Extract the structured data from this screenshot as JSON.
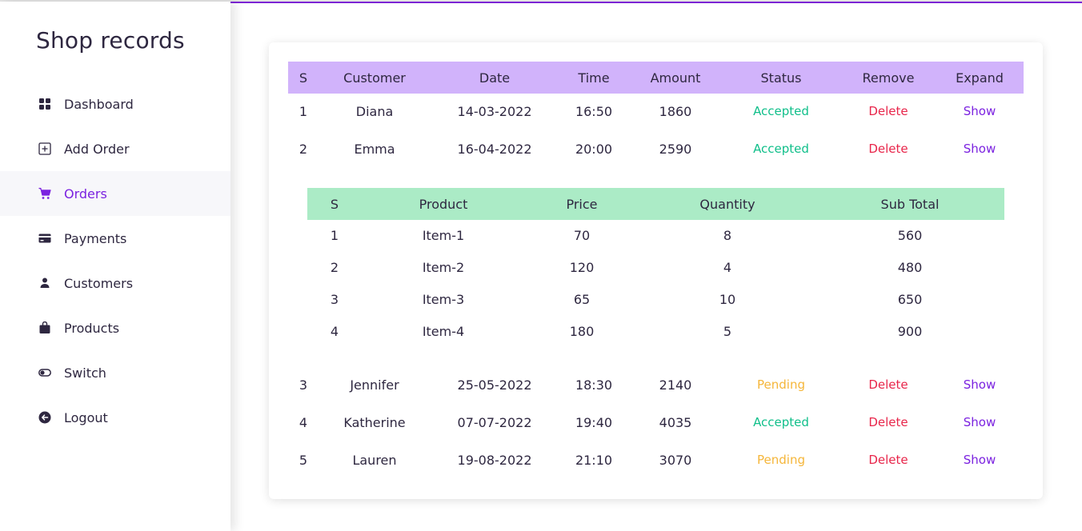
{
  "brand": "Shop records",
  "nav": [
    {
      "label": "Dashboard",
      "icon": "dashboard-grid-icon"
    },
    {
      "label": "Add Order",
      "icon": "add-square-icon"
    },
    {
      "label": "Orders",
      "icon": "cart-icon",
      "active": true
    },
    {
      "label": "Payments",
      "icon": "credit-card-icon"
    },
    {
      "label": "Customers",
      "icon": "user-icon"
    },
    {
      "label": "Products",
      "icon": "bag-icon"
    },
    {
      "label": "Switch",
      "icon": "toggle-icon"
    },
    {
      "label": "Logout",
      "icon": "logout-icon"
    }
  ],
  "orders": {
    "headers": [
      "S",
      "Customer",
      "Date",
      "Time",
      "Amount",
      "Status",
      "Remove",
      "Expand"
    ],
    "rows": [
      {
        "s": "1",
        "customer": "Diana",
        "date": "14-03-2022",
        "time": "16:50",
        "amount": "1860",
        "status": "Accepted",
        "remove": "Delete",
        "expand": "Show"
      },
      {
        "s": "2",
        "customer": "Emma",
        "date": "16-04-2022",
        "time": "20:00",
        "amount": "2590",
        "status": "Accepted",
        "remove": "Delete",
        "expand": "Show"
      },
      {
        "s": "3",
        "customer": "Jennifer",
        "date": "25-05-2022",
        "time": "18:30",
        "amount": "2140",
        "status": "Pending",
        "remove": "Delete",
        "expand": "Show"
      },
      {
        "s": "4",
        "customer": "Katherine",
        "date": "07-07-2022",
        "time": "19:40",
        "amount": "4035",
        "status": "Accepted",
        "remove": "Delete",
        "expand": "Show"
      },
      {
        "s": "5",
        "customer": "Lauren",
        "date": "19-08-2022",
        "time": "21:10",
        "amount": "3070",
        "status": "Pending",
        "remove": "Delete",
        "expand": "Show"
      }
    ]
  },
  "details": {
    "headers": [
      "S",
      "Product",
      "Price",
      "Quantity",
      "Sub Total"
    ],
    "rows": [
      {
        "s": "1",
        "product": "Item-1",
        "price": "70",
        "quantity": "8",
        "subtotal": "560"
      },
      {
        "s": "2",
        "product": "Item-2",
        "price": "120",
        "quantity": "4",
        "subtotal": "480"
      },
      {
        "s": "3",
        "product": "Item-3",
        "price": "65",
        "quantity": "10",
        "subtotal": "650"
      },
      {
        "s": "4",
        "product": "Item-4",
        "price": "180",
        "quantity": "5",
        "subtotal": "900"
      }
    ]
  },
  "colors": {
    "accent": "#7b22e0",
    "orders_header_bg": "#d1b3fb",
    "details_header_bg": "#abebc6",
    "accepted": "#10bf8a",
    "pending": "#f5b63a",
    "delete": "#e8254a"
  }
}
